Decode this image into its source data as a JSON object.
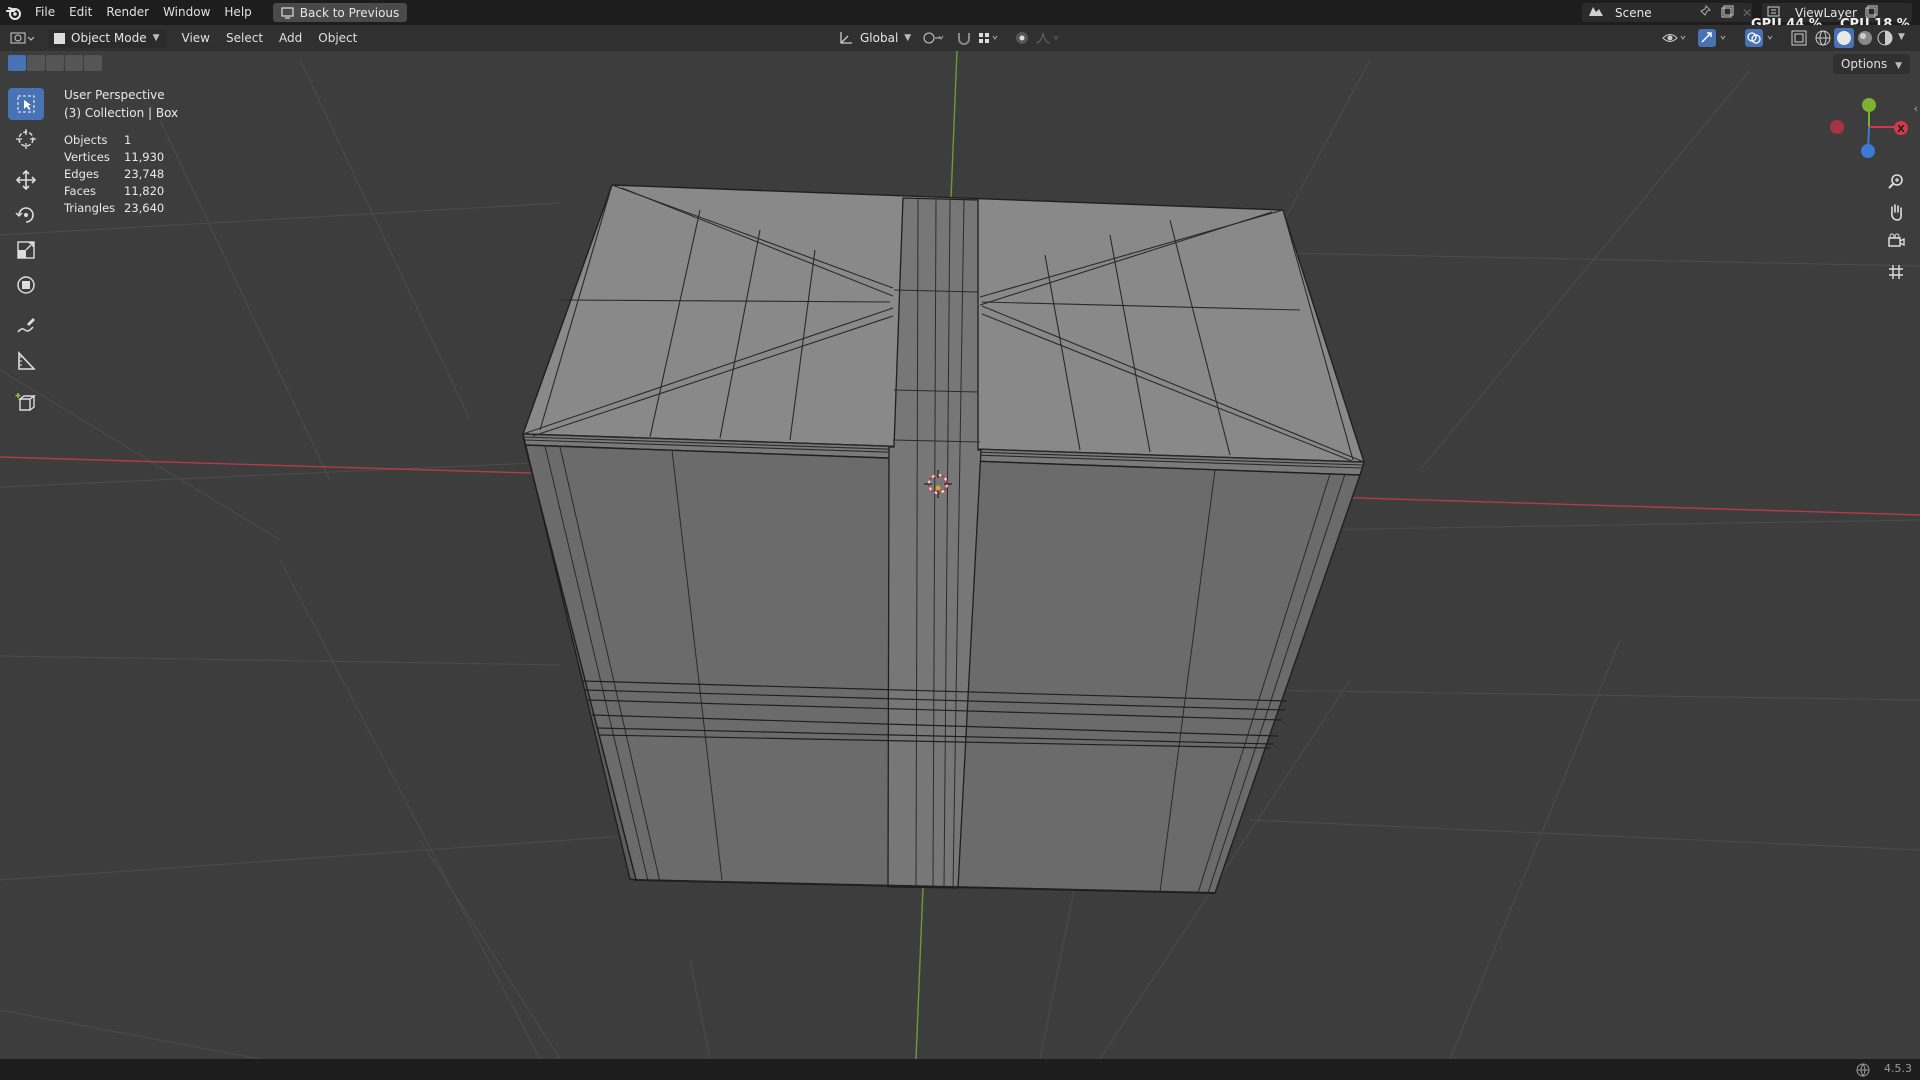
{
  "menu": {
    "items": [
      "File",
      "Edit",
      "Render",
      "Window",
      "Help"
    ],
    "back_label": "Back to Previous"
  },
  "scene": {
    "label": "Scene"
  },
  "view_layer": {
    "label": "ViewLayer"
  },
  "hud": {
    "gpu_label": "GPU",
    "gpu_value": "44 %",
    "cpu_label": "CPU",
    "cpu_value": "18 %"
  },
  "header": {
    "mode_label": "Object Mode",
    "menu_items": [
      "View",
      "Select",
      "Add",
      "Object"
    ],
    "transform_orientation": "Global"
  },
  "viewport": {
    "perspective": "User Perspective",
    "collection": "(3) Collection | Box",
    "options_label": "Options",
    "stats": [
      {
        "label": "Objects",
        "value": "1"
      },
      {
        "label": "Vertices",
        "value": "11,930"
      },
      {
        "label": "Edges",
        "value": "23,748"
      },
      {
        "label": "Faces",
        "value": "11,820"
      },
      {
        "label": "Triangles",
        "value": "23,640"
      }
    ]
  },
  "gizmo": {
    "x_label": "X"
  },
  "status": {
    "version": "4.5.3"
  },
  "colors": {
    "x_axis": "#d3394b",
    "y_axis": "#7eb12f",
    "z_axis": "#3b7bd4",
    "accent": "#4772b3",
    "viewport_bg": "#3d3d3d"
  },
  "icons": [
    "blender-logo",
    "back-icon",
    "scene-icon",
    "pin-icon",
    "new-scene-icon",
    "close-icon",
    "view-layer-icon",
    "editor-type-icon",
    "object-mode-icon",
    "orientation-icon",
    "pivot-icon",
    "snap-icon",
    "snap-grid-icon",
    "proportional-icon",
    "falloff-icon",
    "visibility-icon",
    "gizmo-icon",
    "overlay-icon",
    "xray-icon",
    "wireframe-shading-icon",
    "solid-shading-icon",
    "material-shading-icon",
    "rendered-shading-icon",
    "select-box-icon",
    "cursor-icon",
    "move-icon",
    "rotate-icon",
    "scale-icon",
    "transform-icon",
    "annotate-icon",
    "measure-icon",
    "add-cube-icon",
    "zoom-icon",
    "pan-icon",
    "camera-icon",
    "ortho-grid-icon",
    "network-icon"
  ]
}
